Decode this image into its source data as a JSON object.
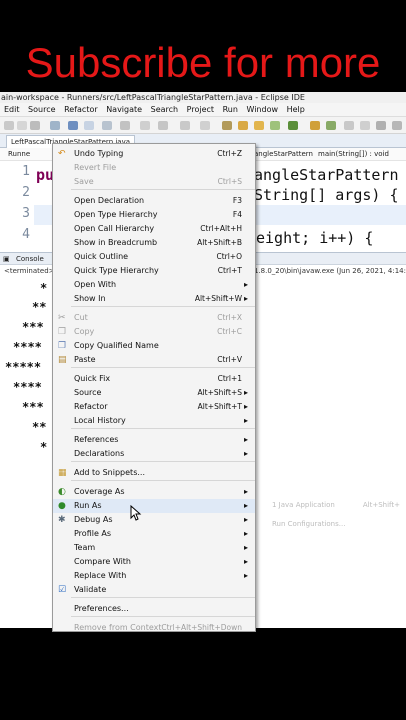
{
  "banner": {
    "text": "Subscribe for more"
  },
  "window": {
    "title": "ain-workspace - Runners/src/LeftPascalTriangleStarPattern.java - Eclipse IDE"
  },
  "menubar": [
    "Edit",
    "Source",
    "Refactor",
    "Navigate",
    "Search",
    "Project",
    "Run",
    "Window",
    "Help"
  ],
  "editor": {
    "tab_label": "LeftPascalTriangleStarPattern.java",
    "breadcrumb_left": "Runne",
    "breadcrumb_class": "angleStarPattern",
    "breadcrumb_method": "main(String[]) : void",
    "line_numbers": [
      "1",
      "2",
      "3",
      "4"
    ],
    "code_line1_kw": "pu",
    "code_line1_rest": "angleStarPattern {",
    "code_line2": "String[] args) {",
    "code_line4": "eight; i++) {"
  },
  "console": {
    "tab_label": "Console",
    "terminated_label": "<terminated>",
    "launch_info": "1.8.0_20\\bin\\javaw.exe (Jun 26, 2021, 4:14:21 P",
    "output_lines": [
      "*",
      "**",
      "***",
      "****",
      "*****",
      "****",
      "***",
      "**",
      "*"
    ]
  },
  "context_menu": {
    "items": [
      {
        "label": "Undo Typing",
        "shortcut": "Ctrl+Z",
        "enabled": true,
        "icon": "undo-icon"
      },
      {
        "label": "Revert File",
        "shortcut": "",
        "enabled": false
      },
      {
        "label": "Save",
        "shortcut": "Ctrl+S",
        "enabled": false
      },
      {
        "label": "Open Declaration",
        "shortcut": "F3",
        "enabled": true
      },
      {
        "label": "Open Type Hierarchy",
        "shortcut": "F4",
        "enabled": true
      },
      {
        "label": "Open Call Hierarchy",
        "shortcut": "Ctrl+Alt+H",
        "enabled": true
      },
      {
        "label": "Show in Breadcrumb",
        "shortcut": "Alt+Shift+B",
        "enabled": true
      },
      {
        "label": "Quick Outline",
        "shortcut": "Ctrl+O",
        "enabled": true
      },
      {
        "label": "Quick Type Hierarchy",
        "shortcut": "Ctrl+T",
        "enabled": true
      },
      {
        "label": "Open With",
        "shortcut": "",
        "enabled": true,
        "submenu": true
      },
      {
        "label": "Show In",
        "shortcut": "Alt+Shift+W",
        "enabled": true,
        "submenu": true
      },
      {
        "label": "Cut",
        "shortcut": "Ctrl+X",
        "enabled": false,
        "icon": "cut-icon"
      },
      {
        "label": "Copy",
        "shortcut": "Ctrl+C",
        "enabled": false,
        "icon": "copy-icon"
      },
      {
        "label": "Copy Qualified Name",
        "shortcut": "",
        "enabled": true,
        "icon": "copy-qualified-icon"
      },
      {
        "label": "Paste",
        "shortcut": "Ctrl+V",
        "enabled": true,
        "icon": "paste-icon"
      },
      {
        "label": "Quick Fix",
        "shortcut": "Ctrl+1",
        "enabled": true
      },
      {
        "label": "Source",
        "shortcut": "Alt+Shift+S",
        "enabled": true,
        "submenu": true
      },
      {
        "label": "Refactor",
        "shortcut": "Alt+Shift+T",
        "enabled": true,
        "submenu": true
      },
      {
        "label": "Local History",
        "shortcut": "",
        "enabled": true,
        "submenu": true
      },
      {
        "label": "References",
        "shortcut": "",
        "enabled": true,
        "submenu": true
      },
      {
        "label": "Declarations",
        "shortcut": "",
        "enabled": true,
        "submenu": true
      },
      {
        "label": "Add to Snippets...",
        "shortcut": "",
        "enabled": true,
        "icon": "snippet-icon"
      },
      {
        "label": "Coverage As",
        "shortcut": "",
        "enabled": true,
        "submenu": true,
        "icon": "coverage-icon"
      },
      {
        "label": "Run As",
        "shortcut": "",
        "enabled": true,
        "submenu": true,
        "icon": "run-icon",
        "selected": true
      },
      {
        "label": "Debug As",
        "shortcut": "",
        "enabled": true,
        "submenu": true,
        "icon": "debug-icon"
      },
      {
        "label": "Profile As",
        "shortcut": "",
        "enabled": true,
        "submenu": true
      },
      {
        "label": "Team",
        "shortcut": "",
        "enabled": true,
        "submenu": true
      },
      {
        "label": "Compare With",
        "shortcut": "",
        "enabled": true,
        "submenu": true
      },
      {
        "label": "Replace With",
        "shortcut": "",
        "enabled": true,
        "submenu": true
      },
      {
        "label": "Validate",
        "shortcut": "",
        "enabled": true,
        "icon": "check-icon"
      },
      {
        "label": "Preferences...",
        "shortcut": "",
        "enabled": true
      },
      {
        "label": "Remove from Context",
        "shortcut": "Ctrl+Alt+Shift+Down",
        "enabled": false
      }
    ]
  },
  "run_as_submenu": {
    "item1_label": "1 Java Application",
    "item1_shortcut": "Alt+Shift+",
    "item2_label": "Run Configurations..."
  },
  "colors": {
    "banner_text": "#e51818",
    "keyword": "#7f0055",
    "selection": "#dfe9f6"
  }
}
